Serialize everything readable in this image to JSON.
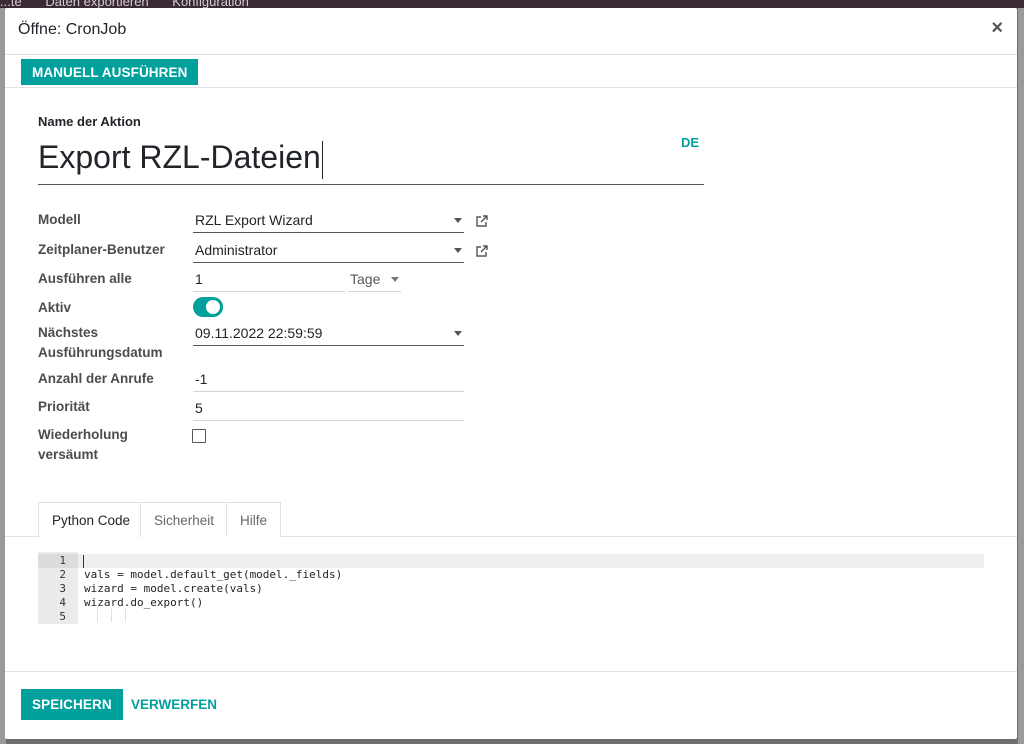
{
  "background": {
    "menu_items": [
      "...te",
      "Daten exportieren",
      "Konfiguration"
    ]
  },
  "modal": {
    "title": "Öffne: CronJob",
    "close_icon": "close-icon"
  },
  "action_bar": {
    "run_manually_label": "MANUELL AUSFÜHREN"
  },
  "form": {
    "name_label": "Name der Aktion",
    "name_value": "Export RZL-Dateien",
    "language_badge": "DE",
    "fields": {
      "model": {
        "label": "Modell",
        "value": "RZL Export Wizard"
      },
      "scheduler_user": {
        "label": "Zeitplaner-Benutzer",
        "value": "Administrator"
      },
      "interval": {
        "label": "Ausführen alle",
        "number": "1",
        "unit": "Tage"
      },
      "active": {
        "label": "Aktiv",
        "value": true
      },
      "next_execution": {
        "label_line1": "Nächstes",
        "label_line2": "Ausführungsdatum",
        "value": "09.11.2022 22:59:59"
      },
      "number_of_calls": {
        "label": "Anzahl der Anrufe",
        "value": "-1"
      },
      "priority": {
        "label": "Priorität",
        "value": "5"
      },
      "repeat_missed": {
        "label_line1": "Wiederholung",
        "label_line2": "versäumt",
        "value": false
      }
    }
  },
  "tabs": [
    {
      "label": "Python Code",
      "active": true
    },
    {
      "label": "Sicherheit",
      "active": false
    },
    {
      "label": "Hilfe",
      "active": false
    }
  ],
  "code": {
    "lines": [
      {
        "num": "1",
        "text": ""
      },
      {
        "num": "2",
        "text": "vals = model.default_get(model._fields)"
      },
      {
        "num": "3",
        "text": "wizard = model.create(vals)"
      },
      {
        "num": "4",
        "text": "wizard.do_export()"
      },
      {
        "num": "5",
        "text": ""
      }
    ]
  },
  "footer": {
    "save_label": "SPEICHERN",
    "discard_label": "VERWERFEN"
  },
  "colors": {
    "accent": "#00a09d",
    "topbar": "#3b2b34"
  }
}
